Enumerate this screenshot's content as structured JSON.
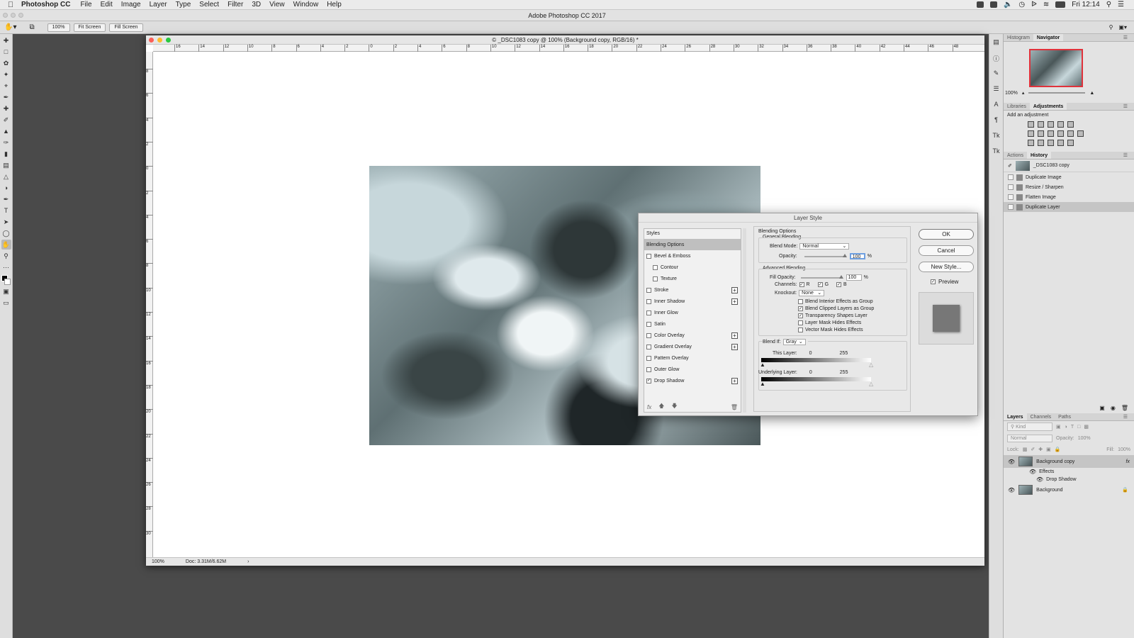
{
  "menubar": {
    "app": "Photoshop CC",
    "menus": [
      "File",
      "Edit",
      "Image",
      "Layer",
      "Type",
      "Select",
      "Filter",
      "3D",
      "View",
      "Window",
      "Help"
    ],
    "clock": "Fri 12:14"
  },
  "app_title": "Adobe Photoshop CC 2017",
  "options_bar": {
    "zoom": "100%",
    "fit_screen": "Fit Screen",
    "fill_screen": "Fill Screen"
  },
  "document": {
    "title": "© _DSC1083 copy @ 100% (Background copy, RGB/16) *",
    "ruler_h": [
      "16",
      "14",
      "12",
      "10",
      "8",
      "6",
      "4",
      "2",
      "0",
      "2",
      "4",
      "6",
      "8",
      "10",
      "12",
      "14",
      "16",
      "18",
      "20",
      "22",
      "24",
      "26",
      "28",
      "30",
      "32",
      "34",
      "36",
      "38",
      "40",
      "42",
      "44",
      "46",
      "48"
    ],
    "ruler_v": [
      "8",
      "6",
      "4",
      "2",
      "0",
      "2",
      "4",
      "6",
      "8",
      "10",
      "12",
      "14",
      "16",
      "18",
      "20",
      "22",
      "24",
      "26",
      "28",
      "30"
    ],
    "status_zoom": "100%",
    "status_doc": "Doc: 3.31M/6.62M"
  },
  "panels": {
    "nav_tabs": [
      "Histogram",
      "Navigator"
    ],
    "nav_zoom": "100%",
    "adj_tabs": [
      "Libraries",
      "Adjustments"
    ],
    "adj_title": "Add an adjustment",
    "hist_tabs": [
      "Actions",
      "History"
    ],
    "history_snapshot": "_DSC1083 copy",
    "history_items": [
      "Duplicate Image",
      "Resize / Sharpen",
      "Flatten Image",
      "Duplicate Layer"
    ],
    "layers_tabs": [
      "Layers",
      "Channels",
      "Paths"
    ],
    "layers_kind": "Kind",
    "layers_blend": "Normal",
    "layers_opacity_label": "Opacity:",
    "layers_opacity": "100%",
    "layers_lock": "Lock:",
    "layers_fill_label": "Fill:",
    "layers_fill": "100%",
    "layers": {
      "top": "Background copy",
      "effects": "Effects",
      "drop_shadow": "Drop Shadow",
      "bottom": "Background"
    }
  },
  "dialog": {
    "title": "Layer Style",
    "styles_header": "Styles",
    "styles": [
      {
        "label": "Blending Options",
        "checked": null,
        "plus": false,
        "sub": false
      },
      {
        "label": "Bevel & Emboss",
        "checked": false,
        "plus": false,
        "sub": false
      },
      {
        "label": "Contour",
        "checked": false,
        "plus": false,
        "sub": true
      },
      {
        "label": "Texture",
        "checked": false,
        "plus": false,
        "sub": true
      },
      {
        "label": "Stroke",
        "checked": false,
        "plus": true,
        "sub": false
      },
      {
        "label": "Inner Shadow",
        "checked": false,
        "plus": true,
        "sub": false
      },
      {
        "label": "Inner Glow",
        "checked": false,
        "plus": false,
        "sub": false
      },
      {
        "label": "Satin",
        "checked": false,
        "plus": false,
        "sub": false
      },
      {
        "label": "Color Overlay",
        "checked": false,
        "plus": true,
        "sub": false
      },
      {
        "label": "Gradient Overlay",
        "checked": false,
        "plus": true,
        "sub": false
      },
      {
        "label": "Pattern Overlay",
        "checked": false,
        "plus": false,
        "sub": false
      },
      {
        "label": "Outer Glow",
        "checked": false,
        "plus": false,
        "sub": false
      },
      {
        "label": "Drop Shadow",
        "checked": true,
        "plus": true,
        "sub": false
      }
    ],
    "blending_options": "Blending Options",
    "general_blending": "General Blending",
    "blend_mode_label": "Blend Mode:",
    "blend_mode": "Normal",
    "opacity_label": "Opacity:",
    "opacity": "100",
    "pct": "%",
    "advanced_blending": "Advanced Blending",
    "fill_opacity_label": "Fill Opacity:",
    "fill_opacity": "100",
    "channels_label": "Channels:",
    "channel_r": "R",
    "channel_g": "G",
    "channel_b": "B",
    "knockout_label": "Knockout:",
    "knockout": "None",
    "checks": [
      {
        "label": "Blend Interior Effects as Group",
        "checked": false
      },
      {
        "label": "Blend Clipped Layers as Group",
        "checked": true
      },
      {
        "label": "Transparency Shapes Layer",
        "checked": true
      },
      {
        "label": "Layer Mask Hides Effects",
        "checked": false
      },
      {
        "label": "Vector Mask Hides Effects",
        "checked": false
      }
    ],
    "blend_if_label": "Blend If:",
    "blend_if": "Gray",
    "this_layer_label": "This Layer:",
    "this_layer_min": "0",
    "this_layer_max": "255",
    "underlying_label": "Underlying Layer:",
    "underlying_min": "0",
    "underlying_max": "255",
    "ok": "OK",
    "cancel": "Cancel",
    "new_style": "New Style...",
    "preview": "Preview"
  }
}
